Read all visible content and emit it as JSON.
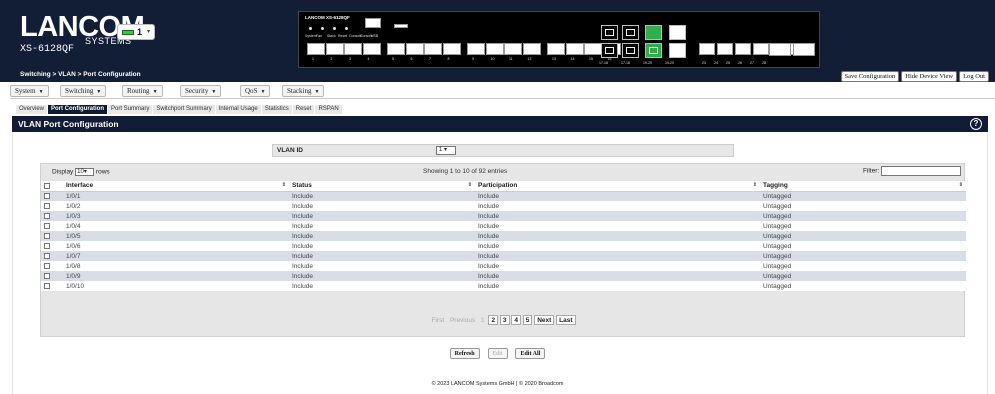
{
  "header": {
    "logo": "LANCOM",
    "logo_sub": "SYSTEMS",
    "model": "XS-6128QF",
    "unit_number": "1",
    "breadcrumb": "Switching > VLAN > Port Configuration",
    "panel_brand": "LANCOM XS-6128QF",
    "panel_leds": [
      "System",
      "Fan",
      "Stack",
      "Reset",
      "Console",
      "Console",
      "USB"
    ],
    "port_numbers": [
      "1",
      "2",
      "3",
      "4",
      "5",
      "6",
      "7",
      "8",
      "9",
      "10",
      "11",
      "12",
      "13",
      "14",
      "15",
      "16",
      "17-18",
      "19-20",
      "21",
      "22",
      "23",
      "24",
      "25",
      "26",
      "27",
      "28"
    ],
    "buttons": [
      "Save Configuration",
      "Hide Device View",
      "Log Out"
    ]
  },
  "menu": [
    {
      "label": "System"
    },
    {
      "label": "Switching"
    },
    {
      "label": "Routing"
    },
    {
      "label": "Security"
    },
    {
      "label": "QoS"
    },
    {
      "label": "Stacking"
    }
  ],
  "tabs": [
    "Overview",
    "Port Configuration",
    "Port Summary",
    "Switchport Summary",
    "Internal Usage",
    "Statistics",
    "Reset",
    "RSPAN"
  ],
  "active_tab": "Port Configuration",
  "page_title": "VLAN Port Configuration",
  "help_icon": "?",
  "vlan_filter": {
    "label": "VLAN ID",
    "value": "1"
  },
  "table_controls": {
    "display_prefix": "Display",
    "display_value": "10",
    "display_suffix": "rows",
    "showing": "Showing 1 to 10 of 92 entries",
    "filter_label": "Filter:"
  },
  "table": {
    "columns": [
      "Interface",
      "Status",
      "Participation",
      "Tagging"
    ],
    "rows": [
      {
        "interface": "1/0/1",
        "status": "Include",
        "participation": "Include",
        "tagging": "Untagged"
      },
      {
        "interface": "1/0/2",
        "status": "Include",
        "participation": "Include",
        "tagging": "Untagged"
      },
      {
        "interface": "1/0/3",
        "status": "Include",
        "participation": "Include",
        "tagging": "Untagged"
      },
      {
        "interface": "1/0/4",
        "status": "Include",
        "participation": "Include",
        "tagging": "Untagged"
      },
      {
        "interface": "1/0/5",
        "status": "Include",
        "participation": "Include",
        "tagging": "Untagged"
      },
      {
        "interface": "1/0/6",
        "status": "Include",
        "participation": "Include",
        "tagging": "Untagged"
      },
      {
        "interface": "1/0/7",
        "status": "Include",
        "participation": "Include",
        "tagging": "Untagged"
      },
      {
        "interface": "1/0/8",
        "status": "Include",
        "participation": "Include",
        "tagging": "Untagged"
      },
      {
        "interface": "1/0/9",
        "status": "Include",
        "participation": "Include",
        "tagging": "Untagged"
      },
      {
        "interface": "1/0/10",
        "status": "Include",
        "participation": "Include",
        "tagging": "Untagged"
      }
    ]
  },
  "pagination": [
    "First",
    "Previous",
    "1",
    "2",
    "3",
    "4",
    "5",
    "Next",
    "Last"
  ],
  "actions": [
    "Refresh",
    "Edit",
    "Edit All"
  ],
  "footer": "© 2023 LANCOM Systems GmbH | © 2020 Broadcom",
  "colors": {
    "header_bg": "#121d36",
    "row_alt": "#d8dde8",
    "port_active": "#2fae4a"
  }
}
